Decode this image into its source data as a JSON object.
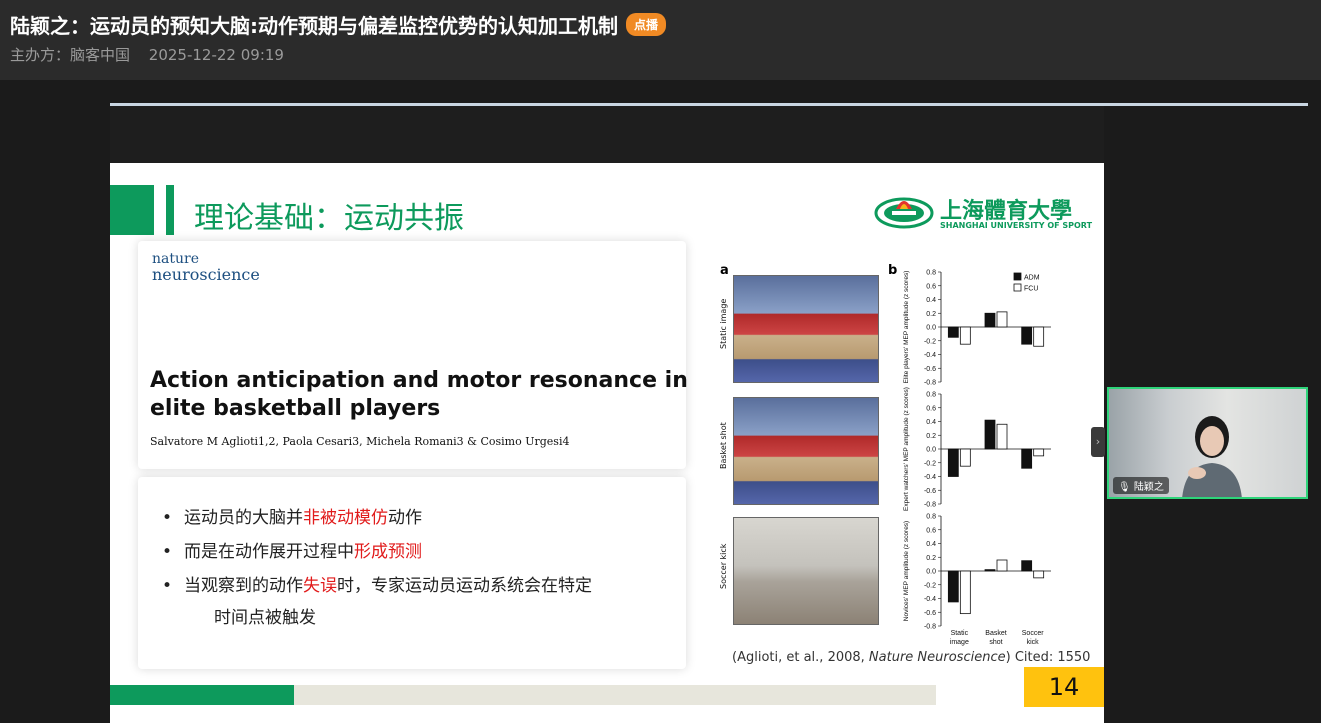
{
  "header": {
    "title": "陆颖之：运动员的预知大脑:动作预期与偏差监控优势的认知加工机制",
    "badge": "点播",
    "organizer": "主办方：脑客中国",
    "datetime": "2025-12-22 09:19"
  },
  "slide": {
    "title": "理论基础：运动共振",
    "logo_cn": "上海體育大學",
    "logo_en": "SHANGHAI UNIVERSITY OF SPORT",
    "journal_line1": "nature",
    "journal_line2": "neuroscience",
    "paper_title": "Action anticipation and motor resonance in elite basketball players",
    "authors": "Salvatore M Aglioti1,2, Paola Cesari3, Michela Romani3 & Cosimo Urgesi4",
    "bullets": [
      {
        "pre": "运动员的大脑并",
        "hl": "非被动模仿",
        "post": "动作"
      },
      {
        "pre": "而是在动作展开过程中",
        "hl": "形成预测",
        "post": ""
      },
      {
        "pre": "当观察到的动作",
        "hl": "失误",
        "post": "时，专家运动员运动系统会在特定"
      }
    ],
    "bullet3_cont": "时间点被触发",
    "fig_a": "a",
    "fig_b": "b",
    "row_labels": [
      "Static image",
      "Basket shot",
      "Soccer kick"
    ],
    "citation_pre": "(Aglioti, et al., 2008, ",
    "citation_journal": "Nature Neuroscience",
    "citation_post": ") Cited: 1550",
    "page_number": "14"
  },
  "chart_data": {
    "type": "bar",
    "categories": [
      "Static image",
      "Basket shot",
      "Soccer kick"
    ],
    "legend": [
      "ADM",
      "FCU"
    ],
    "ylabel_panels": [
      "Elite players' MEP amplitude (z scores)",
      "Expert watchers' MEP amplitude (z scores)",
      "Novices' MEP amplitude (z scores)"
    ],
    "ylim": [
      -0.8,
      0.8
    ],
    "yticks": [
      "0.8",
      "0.6",
      "0.4",
      "0.2",
      "0.0",
      "-0.2",
      "-0.4",
      "-0.6",
      "-0.8"
    ],
    "panels": [
      {
        "name": "Elite players",
        "series": [
          {
            "name": "ADM",
            "values": [
              -0.15,
              0.2,
              -0.25
            ]
          },
          {
            "name": "FCU",
            "values": [
              -0.25,
              0.22,
              -0.28
            ]
          }
        ]
      },
      {
        "name": "Expert watchers",
        "series": [
          {
            "name": "ADM",
            "values": [
              -0.4,
              0.42,
              -0.28
            ]
          },
          {
            "name": "FCU",
            "values": [
              -0.25,
              0.36,
              -0.1
            ]
          }
        ]
      },
      {
        "name": "Novices",
        "series": [
          {
            "name": "ADM",
            "values": [
              -0.45,
              0.02,
              0.15
            ]
          },
          {
            "name": "FCU",
            "values": [
              -0.62,
              0.16,
              -0.1
            ]
          }
        ]
      }
    ],
    "grid": false
  },
  "webcam": {
    "name": "陆颖之"
  },
  "colors": {
    "accent": "#0d9a5c",
    "highlight": "#e11b1b",
    "badge": "#f08a24",
    "page_box": "#ffc20e"
  }
}
